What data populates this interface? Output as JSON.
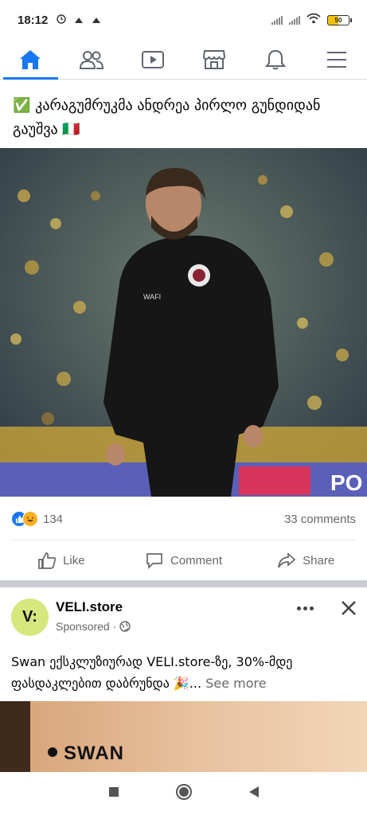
{
  "status_bar": {
    "time": "18:12",
    "battery": "50"
  },
  "nav": {
    "tabs": [
      {
        "name": "home",
        "icon": "home-icon",
        "active": true
      },
      {
        "name": "friends",
        "icon": "friends-icon"
      },
      {
        "name": "watch",
        "icon": "video-icon"
      },
      {
        "name": "marketplace",
        "icon": "marketplace-icon"
      },
      {
        "name": "notifications",
        "icon": "bell-icon"
      },
      {
        "name": "menu",
        "icon": "hamburger-menu-icon"
      }
    ]
  },
  "post": {
    "text": "✅ კარაგუმრუკმა ანდრეა პირლო გუნდიდან გაუშვა 🇮🇹",
    "reaction_count": "134",
    "comments": "33 comments",
    "actions": {
      "like": "Like",
      "comment": "Comment",
      "share": "Share"
    },
    "jacket_brand": "WAFI",
    "banner_text": "PO"
  },
  "ad": {
    "avatar_text": "V:",
    "page_name": "VELI.store",
    "sponsored": "Sponsored ·",
    "text": "Swan ექსკლუზიურად VELI.store-ზე, 30%-მდე ფასდაკლებით დაბრუნდა 🎉...",
    "see_more": " See more",
    "image_brand": "SWAN"
  },
  "colors": {
    "accent": "#1877f2",
    "secondary_text": "#65676b",
    "avatar_bg": "#d6e77d"
  }
}
